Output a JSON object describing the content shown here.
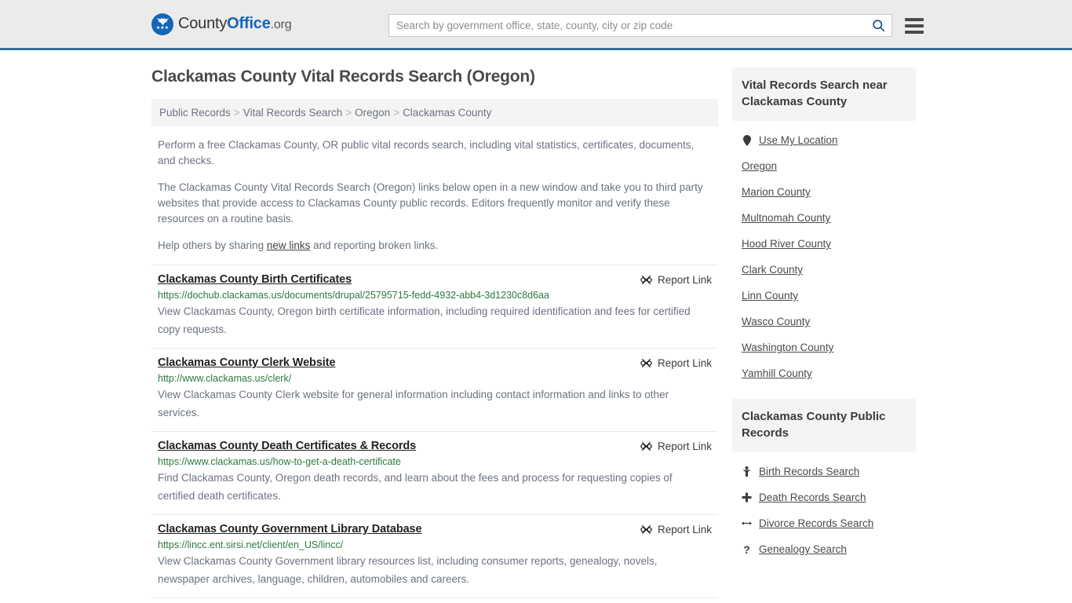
{
  "header": {
    "logo": {
      "name_part1": "County",
      "name_part2": "Office",
      "name_part3": ".org",
      "bird_glyph": "ὔ",
      "stars_glyph": "★★★"
    },
    "search": {
      "placeholder": "Search by government office, state, county, city or zip code",
      "value": "",
      "search_icon": "search-icon",
      "menu_icon": "hamburger-menu-icon"
    }
  },
  "page": {
    "title": "Clackamas County Vital Records Search (Oregon)"
  },
  "breadcrumb": {
    "separator": ">",
    "items": [
      {
        "label": "Public Records"
      },
      {
        "label": "Vital Records Search"
      },
      {
        "label": "Oregon"
      },
      {
        "label": "Clackamas County"
      }
    ]
  },
  "intro": {
    "paragraph1": "Perform a free Clackamas County, OR public vital records search, including vital statistics, certificates, documents, and checks.",
    "paragraph2": "The Clackamas County Vital Records Search (Oregon) links below open in a new window and take you to third party websites that provide access to Clackamas County public records. Editors frequently monitor and verify these resources on a routine basis.",
    "paragraph3_pre": "Help others by sharing ",
    "paragraph3_link": "new links",
    "paragraph3_post": " and reporting broken links."
  },
  "report_link": {
    "label": "Report Link",
    "icon": "broken-link-icon"
  },
  "results": [
    {
      "title": "Clackamas County Birth Certificates",
      "url": "https://dochub.clackamas.us/documents/drupal/25795715-fedd-4932-abb4-3d1230c8d6aa",
      "description": "View Clackamas County, Oregon birth certificate information, including required identification and fees for certified copy requests."
    },
    {
      "title": "Clackamas County Clerk Website",
      "url": "http://www.clackamas.us/clerk/",
      "description": "View Clackamas County Clerk website for general information including contact information and links to other services."
    },
    {
      "title": "Clackamas County Death Certificates & Records",
      "url": "https://www.clackamas.us/how-to-get-a-death-certificate",
      "description": "Find Clackamas County, Oregon death records, and learn about the fees and process for requesting copies of certified death certificates."
    },
    {
      "title": "Clackamas County Government Library Database",
      "url": "https://lincc.ent.sirsi.net/client/en_US/lincc/",
      "description": "View Clackamas County Government library resources list, including consumer reports, genealogy, novels, newspaper archives, language, children, automobiles and careers."
    }
  ],
  "sidebar": {
    "nearby": {
      "heading": "Vital Records Search near Clackamas County",
      "items": [
        {
          "label": "Use My Location",
          "icon": "map-pin-icon"
        },
        {
          "label": "Oregon",
          "icon": ""
        },
        {
          "label": "Marion County",
          "icon": ""
        },
        {
          "label": "Multnomah County",
          "icon": ""
        },
        {
          "label": "Hood River County",
          "icon": ""
        },
        {
          "label": "Clark County",
          "icon": ""
        },
        {
          "label": "Linn County",
          "icon": ""
        },
        {
          "label": "Wasco County",
          "icon": ""
        },
        {
          "label": "Washington County",
          "icon": ""
        },
        {
          "label": "Yamhill County",
          "icon": ""
        }
      ]
    },
    "public_records": {
      "heading": "Clackamas County Public Records",
      "items": [
        {
          "label": "Birth Records Search",
          "icon": "baby-icon",
          "glyph": "Ɣ"
        },
        {
          "label": "Death Records Search",
          "icon": "cross-icon",
          "glyph": "✚"
        },
        {
          "label": "Divorce Records Search",
          "icon": "divorce-arrows-icon",
          "glyph": "↔"
        },
        {
          "label": "Genealogy Search",
          "icon": "question-mark-icon",
          "glyph": "?"
        }
      ]
    }
  },
  "colors": {
    "header_bg": "#ebebeb",
    "header_border": "#34709e",
    "brand_blue": "#1565b8",
    "url_green": "#2b7a3d",
    "panel_gray": "#f4f4f4",
    "body_text": "#6b7280"
  }
}
